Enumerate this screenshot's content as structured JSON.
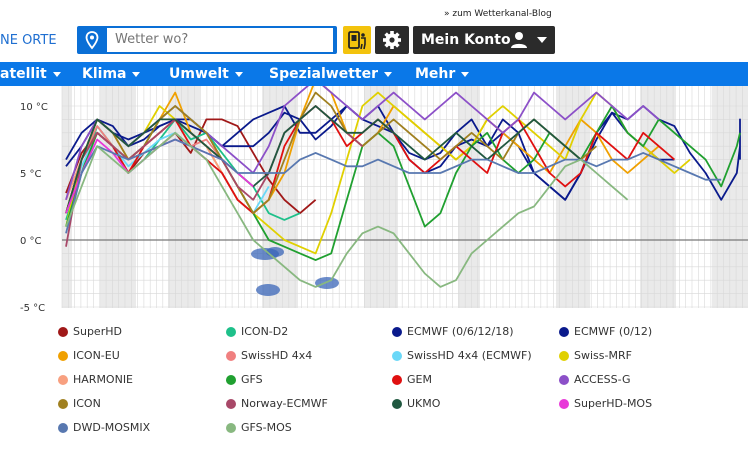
{
  "header": {
    "places_label": "NE ORTE",
    "blog_link": "» zum Wetterkanal-Blog",
    "search": {
      "placeholder": "Wetter wo?"
    },
    "account_label": "Mein Konto",
    "icons": [
      "location-pin-icon",
      "search-icon",
      "phone-app-icon",
      "gear-icon",
      "user-icon",
      "chevron-down-icon"
    ]
  },
  "nav": {
    "items": [
      {
        "label": "atellit"
      },
      {
        "label": "Klima"
      },
      {
        "label": "Umwelt"
      },
      {
        "label": "Spezialwetter"
      },
      {
        "label": "Mehr"
      }
    ]
  },
  "chart_data": {
    "type": "line",
    "yticks": [
      "10 °C",
      "5 °C",
      "0 °C",
      "-5 °C"
    ],
    "ylim": [
      -5,
      10.5
    ],
    "grid": true,
    "series": [
      {
        "name": "SuperHD",
        "color": "#a01818",
        "values": [
          3.5,
          6.5,
          8,
          7,
          5,
          6.5,
          7,
          8,
          6.5,
          9,
          9,
          8.5,
          6.5,
          4.5,
          3,
          2,
          3
        ]
      },
      {
        "name": "ICON-D2",
        "color": "#1ec08a",
        "values": [
          1.5,
          5,
          8.5,
          7,
          5,
          6,
          7.5,
          9,
          7.5,
          8,
          6.5,
          5,
          4,
          2,
          1.5,
          2
        ]
      },
      {
        "name": "ECMWF (0/6/12/18)",
        "color": "#0a1a8c",
        "values": [
          5.5,
          7,
          9,
          8.5,
          7,
          7.5,
          8.5,
          9,
          8.5,
          8,
          7,
          7,
          7,
          8,
          9.5,
          9,
          7.5,
          8.5,
          10,
          9,
          10,
          8,
          6,
          5,
          5.5,
          7,
          7.5,
          7,
          9,
          8,
          5,
          4,
          3,
          5,
          7.5,
          9.5,
          9,
          10,
          9,
          8.5,
          6.5,
          5,
          3,
          5,
          7,
          9,
          9,
          8,
          7,
          6,
          6
        ]
      },
      {
        "name": "ECMWF (0/12)",
        "color": "#0a1a8c",
        "values": [
          6,
          8,
          9,
          8,
          7.5,
          8,
          8.5,
          9,
          9,
          8,
          7,
          8,
          9,
          9.5,
          10,
          8,
          8,
          9,
          10,
          9,
          8.5,
          8,
          6.5,
          6,
          6.5,
          8,
          9,
          7,
          8,
          7,
          5,
          4,
          3,
          5,
          8,
          9.5,
          8,
          7,
          6,
          6
        ]
      },
      {
        "name": "ICON-EU",
        "color": "#f0a000",
        "values": [
          2,
          6,
          9,
          8,
          6,
          7,
          9,
          11,
          8,
          7,
          5,
          3,
          2,
          3,
          5,
          9,
          12,
          11,
          8,
          7,
          8,
          10,
          9,
          8,
          7,
          6,
          7,
          9,
          8,
          7,
          6,
          5,
          7,
          9,
          8,
          6,
          5,
          6,
          7
        ]
      },
      {
        "name": "SwissHD 4x4",
        "color": "#f08080",
        "values": [
          3,
          6,
          8.5,
          7,
          6,
          6.5,
          7,
          8,
          7,
          7.5,
          6,
          4,
          2
        ]
      },
      {
        "name": "SwissHD 4x4 (ECMWF)",
        "color": "#6ad8f8",
        "values": [
          2,
          5.5,
          8,
          7,
          5.5,
          6.5,
          7.5,
          8,
          7,
          6,
          5,
          3,
          2,
          4
        ]
      },
      {
        "name": "Swiss-MRF",
        "color": "#e0d000",
        "values": [
          1,
          6,
          9,
          8,
          7,
          8,
          10,
          9,
          8,
          7,
          6,
          4,
          2,
          1,
          0,
          -0.5,
          -1,
          2,
          6,
          10,
          11,
          10,
          9,
          8,
          7,
          6,
          7,
          9,
          10,
          9,
          8,
          7,
          6,
          9,
          11,
          10,
          8,
          7,
          6,
          5,
          6
        ]
      },
      {
        "name": "HARMONIE",
        "color": "#f8a080",
        "values": [
          3,
          6,
          8,
          7,
          6,
          7,
          8,
          9,
          8,
          7,
          5,
          3,
          2
        ]
      },
      {
        "name": "GFS",
        "color": "#20a030",
        "values": [
          1,
          5,
          8,
          7,
          6,
          7,
          9,
          10,
          9,
          8,
          6,
          4,
          2,
          0,
          -0.5,
          -1,
          -1.5,
          -1,
          3,
          7,
          8,
          7,
          4,
          1,
          2,
          5,
          7,
          8,
          6,
          5,
          6,
          8,
          7,
          6,
          8,
          10,
          8,
          7,
          9,
          8,
          7,
          6,
          4,
          7,
          8
        ]
      },
      {
        "name": "GEM",
        "color": "#e01010",
        "values": [
          2,
          6,
          8,
          7,
          5,
          7,
          8,
          9,
          7,
          6,
          5,
          3,
          2,
          3,
          7,
          9,
          10,
          9,
          7,
          8,
          9,
          8,
          6,
          5,
          6,
          7,
          6,
          5,
          8,
          9,
          7,
          5,
          4,
          5,
          8,
          7,
          6,
          8,
          7,
          6
        ]
      },
      {
        "name": "ACCESS-G",
        "color": "#8c50c8",
        "values": [
          3,
          7,
          9,
          8,
          7,
          8,
          9,
          10,
          9,
          8,
          7,
          6,
          5,
          7,
          10,
          11,
          12,
          11,
          10,
          9,
          10,
          11,
          10,
          9,
          10,
          11,
          10,
          9,
          8,
          9,
          11,
          10,
          9,
          10,
          11,
          10,
          9,
          10,
          9
        ]
      },
      {
        "name": "ICON",
        "color": "#a08020",
        "values": [
          2,
          6,
          9,
          8,
          6,
          7,
          9,
          10,
          9,
          8,
          6,
          4,
          2,
          3,
          6,
          9,
          11,
          10,
          8,
          7,
          8,
          9,
          8,
          7,
          6,
          7,
          8,
          7,
          6,
          8,
          9,
          8,
          7,
          6,
          7
        ]
      },
      {
        "name": "Norway-ECMWF",
        "color": "#a84868",
        "values": [
          -0.5,
          6,
          8,
          7,
          6,
          7,
          8,
          9,
          8,
          7,
          6,
          4,
          3,
          5,
          8,
          9,
          10,
          9,
          8,
          7
        ]
      },
      {
        "name": "UKMO",
        "color": "#205840",
        "values": [
          2,
          6,
          9,
          8,
          7,
          8,
          9,
          9,
          8,
          7,
          6,
          5,
          4,
          5,
          8,
          9,
          10,
          9,
          8,
          8,
          9,
          8,
          7,
          6,
          7,
          8,
          7,
          6,
          7,
          8,
          9,
          8,
          7,
          6
        ]
      },
      {
        "name": "SuperHD-MOS",
        "color": "#e838d8",
        "values": [
          2,
          5,
          7.5,
          6.5,
          5,
          6,
          7,
          7.5,
          7,
          6.5,
          6,
          5,
          4
        ]
      },
      {
        "name": "DWD-MOSMIX",
        "color": "#5878b0",
        "values": [
          0.5,
          5,
          7,
          6.5,
          6,
          6.5,
          7,
          7.5,
          7,
          6.5,
          6,
          5,
          5,
          5,
          5,
          6,
          6.5,
          6,
          5.5,
          5.5,
          6,
          5.5,
          5,
          5,
          5,
          5.5,
          6,
          6,
          5.5,
          5,
          5,
          5.5,
          6,
          6,
          5.5,
          6,
          6,
          6.5,
          6,
          5.5,
          5,
          4.5,
          4.5
        ]
      },
      {
        "name": "GFS-MOS",
        "color": "#88b880",
        "values": [
          1,
          4,
          7,
          6,
          5,
          6,
          7,
          8,
          7,
          6,
          4,
          2,
          0,
          -1,
          -2,
          -3,
          -3.5,
          -3,
          -1,
          0.5,
          1,
          0.5,
          -1,
          -2.5,
          -3.5,
          -3,
          -1,
          0,
          1,
          2,
          2.5,
          4,
          5.5,
          6,
          5,
          4,
          3
        ]
      }
    ]
  },
  "legend_title_note": ""
}
